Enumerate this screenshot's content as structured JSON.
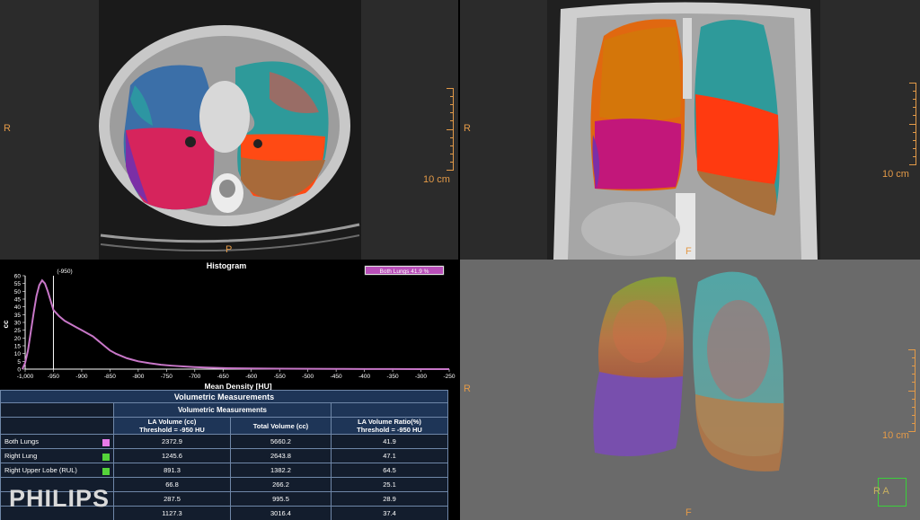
{
  "viewports": {
    "axial": {
      "orientation_left": "R",
      "orientation_bottom": "P",
      "scale_label": "10 cm"
    },
    "coronal": {
      "orientation_left": "R",
      "orientation_bottom": "F",
      "scale_label": "10 cm"
    },
    "volume": {
      "orientation_left": "R",
      "orientation_bottom": "F",
      "scale_label": "10 cm",
      "cube_label": "R A"
    }
  },
  "histogram": {
    "title": "Histogram",
    "legend": "Both Lungs 41.9 %",
    "threshold_label": "(-950)",
    "ylabel": "cc",
    "xlabel": "Mean Density [HU]",
    "colors": {
      "curve": "#c877c8",
      "threshold": "#ffffff",
      "legend_fill": "#b84fb8"
    }
  },
  "chart_data": {
    "type": "line",
    "title": "Histogram",
    "xlabel": "Mean Density [HU]",
    "ylabel": "cc",
    "xlim": [
      -1000,
      -250
    ],
    "ylim": [
      0,
      60
    ],
    "xticks": [
      "-1,000",
      "-950",
      "-900",
      "-850",
      "-800",
      "-750",
      "-700",
      "-650",
      "-600",
      "-550",
      "-500",
      "-450",
      "-400",
      "-350",
      "-300",
      "-250"
    ],
    "yticks": [
      "0",
      "5",
      "10",
      "15",
      "20",
      "25",
      "30",
      "35",
      "40",
      "45",
      "50",
      "55",
      "60"
    ],
    "threshold": -950,
    "series": [
      {
        "name": "Both Lungs 41.9 %",
        "x": [
          -1010,
          -1000,
          -995,
          -990,
          -985,
          -980,
          -975,
          -970,
          -965,
          -960,
          -955,
          -950,
          -940,
          -930,
          -920,
          -910,
          -900,
          -890,
          -880,
          -870,
          -860,
          -850,
          -840,
          -830,
          -820,
          -810,
          -800,
          -780,
          -760,
          -740,
          -720,
          -700,
          -680,
          -660,
          -640,
          -620,
          -600,
          -550,
          -500,
          -450,
          -400,
          -350,
          -300,
          -250
        ],
        "y": [
          0,
          4,
          12,
          24,
          36,
          47,
          54,
          57,
          55,
          50,
          44,
          38,
          34,
          31,
          29,
          27,
          25,
          23,
          21,
          18,
          15,
          12,
          10,
          8.5,
          7,
          6,
          5,
          3.8,
          2.8,
          2.2,
          1.7,
          1.3,
          1.0,
          0.8,
          0.6,
          0.5,
          0.4,
          0.3,
          0.2,
          0.15,
          0.1,
          0.05,
          0.02,
          0
        ]
      }
    ]
  },
  "table": {
    "title": "Volumetric Measurements",
    "subtitle": "Volumetric Measurements",
    "headers": {
      "la_volume_line1": "LA Volume (cc)",
      "la_volume_line2": "Threshold = -950 HU",
      "total_volume": "Total Volume (cc)",
      "ratio_line1": "LA Volume Ratio(%)",
      "ratio_line2": "Threshold = -950 HU"
    },
    "rows": [
      {
        "name": "Both Lungs",
        "swatch": "#e87ae8",
        "la": "2372.9",
        "total": "5660.2",
        "ratio": "41.9"
      },
      {
        "name": "Right Lung",
        "swatch": "#55d43a",
        "la": "1245.6",
        "total": "2643.8",
        "ratio": "47.1"
      },
      {
        "name": "Right Upper Lobe (RUL)",
        "swatch": "#55d43a",
        "la": "891.3",
        "total": "1382.2",
        "ratio": "64.5"
      },
      {
        "name": "",
        "swatch": "",
        "la": "66.8",
        "total": "266.2",
        "ratio": "25.1"
      },
      {
        "name": "",
        "swatch": "",
        "la": "287.5",
        "total": "995.5",
        "ratio": "28.9"
      },
      {
        "name": "",
        "swatch": "",
        "la": "1127.3",
        "total": "3016.4",
        "ratio": "37.4"
      }
    ]
  },
  "brand": {
    "logo_text": "PHILIPS"
  }
}
